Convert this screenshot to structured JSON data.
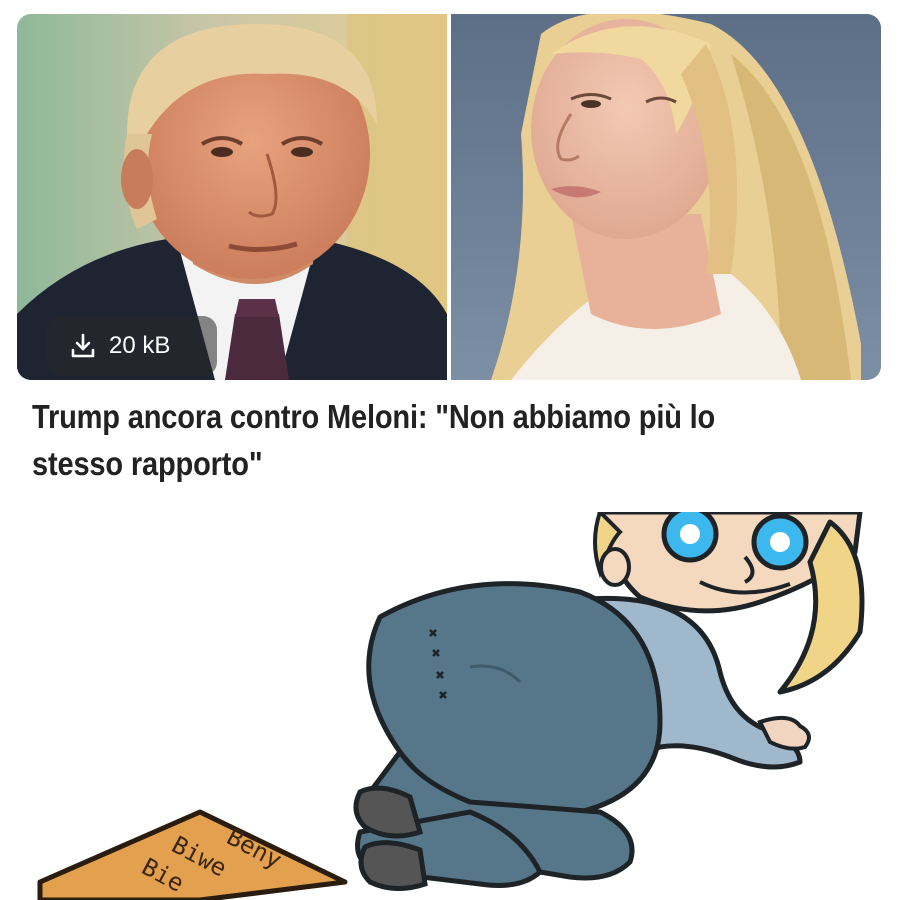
{
  "post": {
    "download_size": "20 kB",
    "download_icon": "download-icon",
    "headline": "Trump ancora contro Meloni: \"Non abbiamo più lo stesso rapporto\""
  },
  "cartoon": {
    "doormat_text_lines": [
      "Beny",
      "Biwe",
      "Bie"
    ]
  },
  "colors": {
    "headline_text": "#222222",
    "chip_background": "rgba(40,40,40,0.55)",
    "mat": "#e3a04e",
    "jeans": "#567789",
    "sweater": "#9fb8cc",
    "hair": "#f0d488",
    "eyes": "#3db8ee"
  }
}
